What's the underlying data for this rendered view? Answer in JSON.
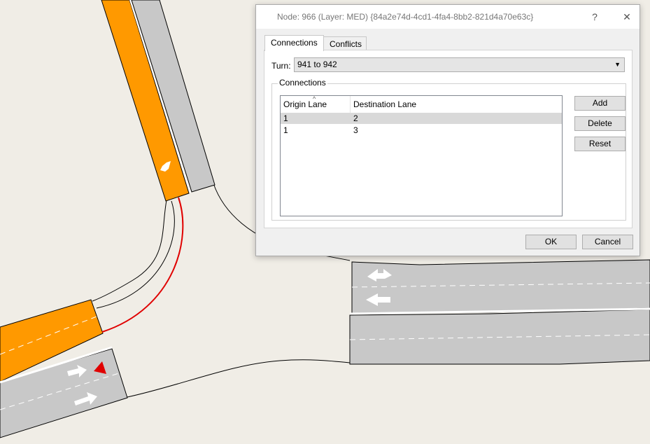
{
  "dialog": {
    "title": "Node: 966 (Layer: MED) {84a2e74d-4cd1-4fa4-8bb2-821d4a70e63c}",
    "help_label": "?",
    "close_label": "✕",
    "tabs": [
      {
        "label": "Connections",
        "active": true
      },
      {
        "label": "Conflicts",
        "active": false
      }
    ],
    "turn": {
      "label": "Turn:",
      "value": "941 to 942"
    },
    "connections": {
      "group_label": "Connections",
      "columns": [
        "Origin Lane",
        "Destination Lane"
      ],
      "rows": [
        {
          "origin": "1",
          "destination": "2",
          "selected": true
        },
        {
          "origin": "1",
          "destination": "3",
          "selected": false
        }
      ],
      "buttons": {
        "add": "Add",
        "delete": "Delete",
        "reset": "Reset"
      }
    },
    "ok_label": "OK",
    "cancel_label": "Cancel"
  },
  "colors": {
    "background": "#f0ede6",
    "road": "#c8c8c8",
    "selected_link": "#ff9900",
    "connector": "#e00000",
    "arrows": "#ffffff"
  }
}
